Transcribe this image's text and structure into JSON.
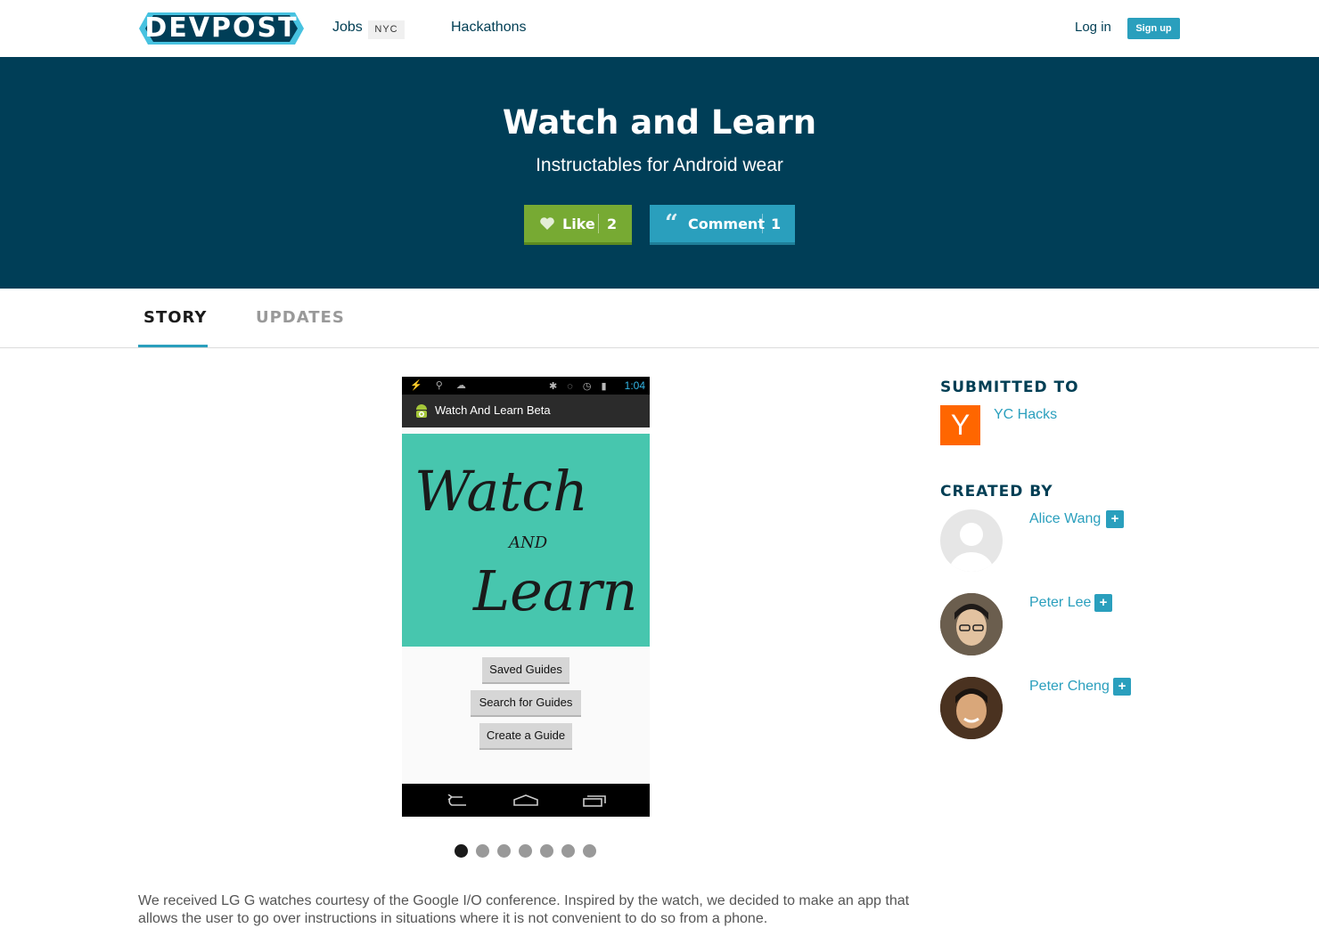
{
  "nav": {
    "logo": "DEVPOST",
    "jobs": "Jobs",
    "jobs_badge": "NYC",
    "hackathons": "Hackathons",
    "login": "Log in",
    "signup": "Sign up"
  },
  "hero": {
    "title": "Watch and Learn",
    "subtitle": "Instructables for Android wear",
    "like_label": "Like",
    "like_count": "2",
    "comment_label": "Comment",
    "comment_count": "1"
  },
  "tabs": [
    "STORY",
    "UPDATES"
  ],
  "gallery": {
    "status_time": "1:04",
    "app_title": "Watch And Learn Beta",
    "splash_line1": "Watch",
    "splash_line2": "AND",
    "splash_line3": "Learn",
    "buttons": [
      "Saved Guides",
      "Search for Guides",
      "Create a Guide"
    ],
    "slide_count": 7,
    "active_slide": 1
  },
  "story": {
    "text": "We received LG G watches courtesy of the Google I/O conference. Inspired by the watch, we decided to make an app that allows the user to go over instructions in situations where it is not convenient to do so from a phone."
  },
  "sidebar": {
    "submitted_heading": "SUBMITTED TO",
    "hackathon_logo": "Y",
    "hackathon_name": "YC Hacks",
    "created_heading": "CREATED BY",
    "members": [
      {
        "name": "Alice Wang",
        "follow": "+"
      },
      {
        "name": "Peter Lee",
        "follow": "+"
      },
      {
        "name": "Peter Cheng",
        "follow": "+"
      }
    ]
  },
  "colors": {
    "brand_dark": "#003e57",
    "accent": "#2a9fbd",
    "like_green": "#77aa33",
    "yc_orange": "#ff6600"
  }
}
